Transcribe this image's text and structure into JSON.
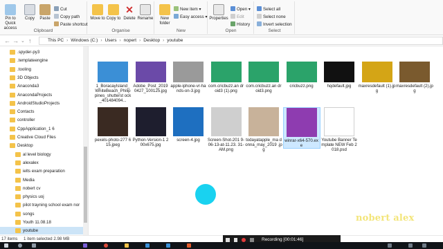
{
  "ribbon": {
    "clipboard": {
      "pin_label": "Pin to Quick access",
      "copy_label": "Copy",
      "paste_label": "Paste",
      "cut_label": "Cut",
      "copy_path_label": "Copy path",
      "paste_shortcut_label": "Paste shortcut",
      "group_label": "Clipboard"
    },
    "organise": {
      "move_to_label": "Move to",
      "copy_to_label": "Copy to",
      "delete_label": "Delete",
      "rename_label": "Rename",
      "group_label": "Organise"
    },
    "new": {
      "new_folder_label": "New folder",
      "new_item_label": "New item ▾",
      "easy_access_label": "Easy access ▾",
      "group_label": "New"
    },
    "open": {
      "properties_label": "Properties",
      "open_label": "Open ▾",
      "edit_label": "Edit",
      "history_label": "History",
      "group_label": "Open"
    },
    "select": {
      "select_all_label": "Select all",
      "select_none_label": "Select none",
      "invert_label": "Invert selection",
      "group_label": "Select"
    }
  },
  "address": {
    "crumbs": [
      "This PC",
      "Windows (C:)",
      "Users",
      "nopert",
      "Desktop",
      "youtube"
    ]
  },
  "nav": {
    "items": [
      {
        "label": ".spyder-py3"
      },
      {
        "label": ".templateengine"
      },
      {
        "label": ".tooling"
      },
      {
        "label": "3D Objects"
      },
      {
        "label": "Anaconda3"
      },
      {
        "label": "AnacondaProjects"
      },
      {
        "label": "AndroidStudioProjects"
      },
      {
        "label": "Contacts"
      },
      {
        "label": "controller"
      },
      {
        "label": "CppApplication_1 6"
      },
      {
        "label": "Creative Cloud Files"
      },
      {
        "label": "Desktop"
      },
      {
        "label": "al level biology"
      },
      {
        "label": "alexalex"
      },
      {
        "label": "ielts exam preparation"
      },
      {
        "label": "Media"
      },
      {
        "label": "nobert cv"
      },
      {
        "label": "physics uoj"
      },
      {
        "label": "pilot trayning school exam nor"
      },
      {
        "label": "songs"
      },
      {
        "label": "Youth 11.08.18"
      },
      {
        "label": "youtube"
      }
    ]
  },
  "files": [
    {
      "name": "1_BoracayIsland_WhiteBeach_Philippines_shutterst ock_401484094...",
      "color": "#3b8fd6"
    },
    {
      "name": "Adobe_Post_2019 0427_100125.jpg",
      "color": "#6b4aa8"
    },
    {
      "name": "apple-iphone-vr-hands-on-3.jpg",
      "color": "#9a9a9a"
    },
    {
      "name": "com.cricbuzz.an droid3 (1).png",
      "color": "#2ba36a"
    },
    {
      "name": "com.cricbuzz.an droid3.png",
      "color": "#2ba36a"
    },
    {
      "name": "cricbuzz.png",
      "color": "#2ba36a"
    },
    {
      "name": "hqdefault.jpg",
      "color": "#111111"
    },
    {
      "name": "maxresdefault (1).jpg",
      "color": "#d4a516"
    },
    {
      "name": "maxresdefault (2).jpg",
      "color": "#7a5a2e"
    },
    {
      "name": "pexels-photo-277 615.jpeg",
      "color": "#3a2a22"
    },
    {
      "name": "Python-Version-1 200x675.jpg",
      "color": "#1e1e2e"
    },
    {
      "name": "screen-4.jpg",
      "color": "#1e6fc0"
    },
    {
      "name": "Screen-Shot-201 9-06-13-at-11.23. 31-AM.png",
      "color": "#cfcfcf"
    },
    {
      "name": "todayatapple_ma donna_may_2019 .jpg",
      "color": "#c8b29a"
    },
    {
      "name": "winrar-x64-570.ex e",
      "color": "#8e3cb0"
    },
    {
      "name": "Youtube Banner Template NEW Feb 2018.psd",
      "color": "#ffffff"
    }
  ],
  "status": {
    "items_count": "17 items",
    "selected": "1 item selected  2.98 MB"
  },
  "recorder": {
    "label": "Recording [00:01:46]"
  },
  "watermark": "nobert alex",
  "colors": {
    "accent": "#19d2f0",
    "selection": "#cce4f7",
    "folder": "#f4c34a"
  }
}
